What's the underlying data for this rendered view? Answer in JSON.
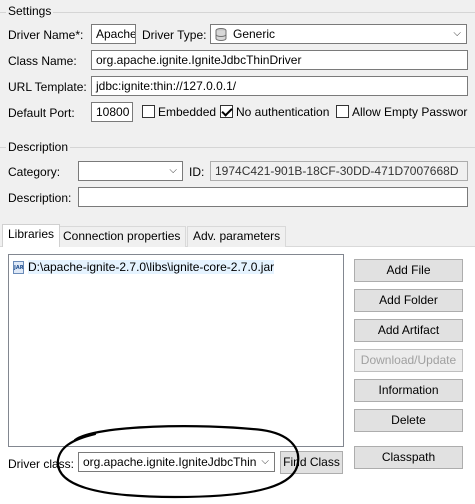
{
  "settings": {
    "title": "Settings",
    "driver_name_label": "Driver Name*:",
    "driver_name_value": "Apache",
    "driver_type_label": "Driver Type:",
    "driver_type_value": "Generic",
    "driver_type_icon": "database-icon",
    "class_name_label": "Class Name:",
    "class_name_value": "org.apache.ignite.IgniteJdbcThinDriver",
    "url_template_label": "URL Template:",
    "url_template_value": "jdbc:ignite:thin://127.0.0.1/",
    "default_port_label": "Default Port:",
    "default_port_value": "10800",
    "embedded_label": "Embedded",
    "embedded_checked": false,
    "no_auth_label": "No authentication",
    "no_auth_checked": true,
    "allow_empty_password_label": "Allow Empty Passwor",
    "allow_empty_password_checked": false
  },
  "description": {
    "title": "Description",
    "category_label": "Category:",
    "category_value": "",
    "id_label": "ID:",
    "id_value": "1974C421-901B-18CF-30DD-471D7007668D",
    "description_label": "Description:",
    "description_value": ""
  },
  "tabs": [
    {
      "label": "Libraries",
      "active": true
    },
    {
      "label": "Connection properties",
      "active": false
    },
    {
      "label": "Adv. parameters",
      "active": false
    }
  ],
  "libraries": {
    "items": [
      {
        "icon": "jar-file-icon",
        "icon_text": "JAR",
        "path": "D:\\apache-ignite-2.7.0\\libs\\ignite-core-2.7.0.jar"
      }
    ],
    "buttons": {
      "add_file": "Add File",
      "add_folder": "Add Folder",
      "add_artifact": "Add Artifact",
      "download_update": "Download/Update",
      "information": "Information",
      "delete": "Delete",
      "classpath": "Classpath"
    },
    "download_update_enabled": false
  },
  "driver_class": {
    "label": "Driver class:",
    "value": "org.apache.ignite.IgniteJdbcThin",
    "find_class_label": "Find Class"
  },
  "colors": {
    "background": "#f0f0f0",
    "annotation": "#000000"
  }
}
